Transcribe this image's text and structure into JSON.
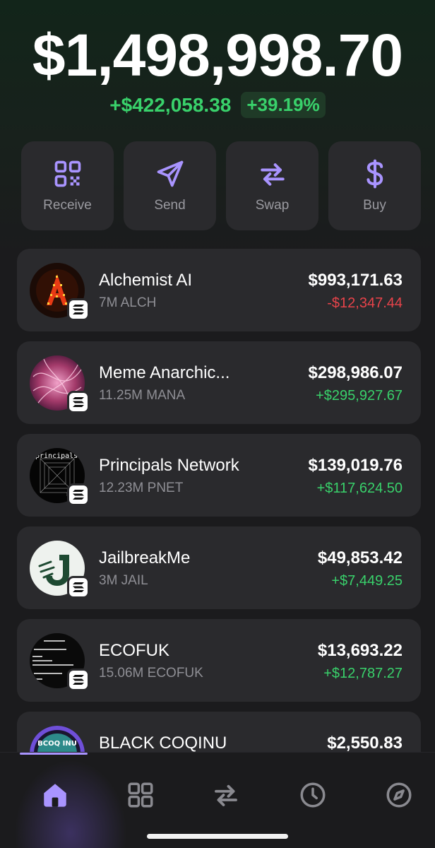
{
  "portfolio": {
    "balance": "$1,498,998.70",
    "change_amount": "+$422,058.38",
    "change_percent": "+39.19%"
  },
  "actions": [
    {
      "label": "Receive",
      "icon": "qr-code-icon"
    },
    {
      "label": "Send",
      "icon": "send-icon"
    },
    {
      "label": "Swap",
      "icon": "swap-icon"
    },
    {
      "label": "Buy",
      "icon": "dollar-icon"
    }
  ],
  "tokens": [
    {
      "name": "Alchemist AI",
      "quantity": "7M ALCH",
      "value": "$993,171.63",
      "delta": "-$12,347.44",
      "direction": "negative"
    },
    {
      "name": "Meme Anarchic...",
      "quantity": "11.25M MANA",
      "value": "$298,986.07",
      "delta": "+$295,927.67",
      "direction": "positive"
    },
    {
      "name": "Principals Network",
      "quantity": "12.23M PNET",
      "value": "$139,019.76",
      "delta": "+$117,624.50",
      "direction": "positive"
    },
    {
      "name": "JailbreakMe",
      "quantity": "3M JAIL",
      "value": "$49,853.42",
      "delta": "+$7,449.25",
      "direction": "positive"
    },
    {
      "name": "ECOFUK",
      "quantity": "15.06M ECOFUK",
      "value": "$13,693.22",
      "delta": "+$12,787.27",
      "direction": "positive"
    },
    {
      "name": "BLACK COQINU",
      "quantity": "",
      "value": "$2,550.83",
      "delta": "",
      "direction": "positive"
    }
  ],
  "token_avatar_text": {
    "principals_top": "principals",
    "principals_bottom": "net",
    "coqinu": "BCOQ INU"
  },
  "tabs": [
    {
      "icon": "home-icon",
      "active": true
    },
    {
      "icon": "grid-icon",
      "active": false
    },
    {
      "icon": "swap-icon",
      "active": false
    },
    {
      "icon": "clock-icon",
      "active": false
    },
    {
      "icon": "compass-icon",
      "active": false
    }
  ],
  "colors": {
    "accent": "#a994ff",
    "positive": "#39d16b",
    "negative": "#e8434a",
    "card": "#2a2a2d"
  }
}
